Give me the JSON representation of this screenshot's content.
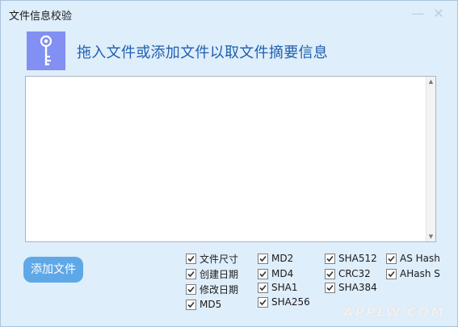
{
  "window": {
    "title": "文件信息校验",
    "min_symbol": "—",
    "close_symbol": "✕"
  },
  "header": {
    "icon": "key-icon",
    "text": "拖入文件或添加文件以取文件摘要信息"
  },
  "file_area": {
    "content": ""
  },
  "add_button_label": "添加文件",
  "options": [
    {
      "label": "文件尺寸",
      "checked": true
    },
    {
      "label": "创建日期",
      "checked": true
    },
    {
      "label": "修改日期",
      "checked": true
    },
    {
      "label": "MD5",
      "checked": true
    },
    {
      "label": "MD2",
      "checked": true
    },
    {
      "label": "MD4",
      "checked": true
    },
    {
      "label": "SHA1",
      "checked": true
    },
    {
      "label": "SHA256",
      "checked": true
    },
    {
      "label": "SHA512",
      "checked": true
    },
    {
      "label": "CRC32",
      "checked": true
    },
    {
      "label": "SHA384",
      "checked": true
    },
    {
      "label": "AS Hash",
      "checked": true
    },
    {
      "label": "AHash S",
      "checked": true
    }
  ],
  "watermark": "APPLW.COM",
  "colors": {
    "accent": "#1e5fae",
    "button": "#5fa8e8",
    "key_tile": "#8190f2",
    "window_bg": "#dfeefb"
  }
}
